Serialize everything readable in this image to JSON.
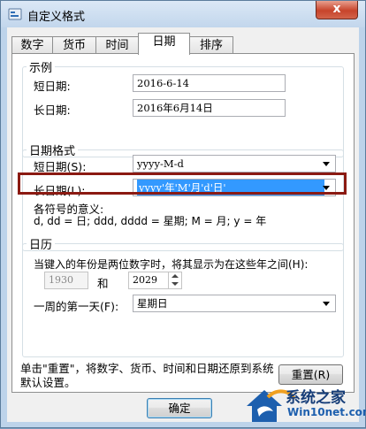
{
  "window": {
    "title": "自定义格式",
    "close_glyph": "x"
  },
  "tabs": [
    {
      "label": "数字"
    },
    {
      "label": "货币"
    },
    {
      "label": "时间"
    },
    {
      "label": "日期"
    },
    {
      "label": "排序"
    }
  ],
  "example": {
    "legend": "示例",
    "short_label": "短日期:",
    "short_value": "2016-6-14",
    "long_label": "长日期:",
    "long_value": "2016年6月14日"
  },
  "format": {
    "legend": "日期格式",
    "short_label": "短日期(S):",
    "short_value": "yyyy-M-d",
    "long_label": "长日期(L):",
    "long_value": "yyyy'年'M'月'd'日'",
    "symbols_title": "各符号的意义:",
    "symbols_line": "d, dd = 日;  ddd, dddd = 星期;  M = 月;  y = 年"
  },
  "calendar": {
    "legend": "日历",
    "two_digit_text": "当键入的年份是两位数字时，将其显示为在这些年之间(H):",
    "from_year": "1930",
    "and_label": "和",
    "to_year": "2029",
    "first_day_label": "一周的第一天(F):",
    "first_day_value": "星期日"
  },
  "footer": {
    "reset_text": "单击\"重置\"，将数字、货币、时间和日期还原到系统默认设置。",
    "reset_button": "重置(R)",
    "ok_button": "确定"
  },
  "watermark": {
    "brand_cn": "系统之家",
    "brand_en": "Win10net.com"
  },
  "colors": {
    "highlight_border": "#8b1a12",
    "selection": "#3399ff",
    "close": "#c7442b"
  }
}
